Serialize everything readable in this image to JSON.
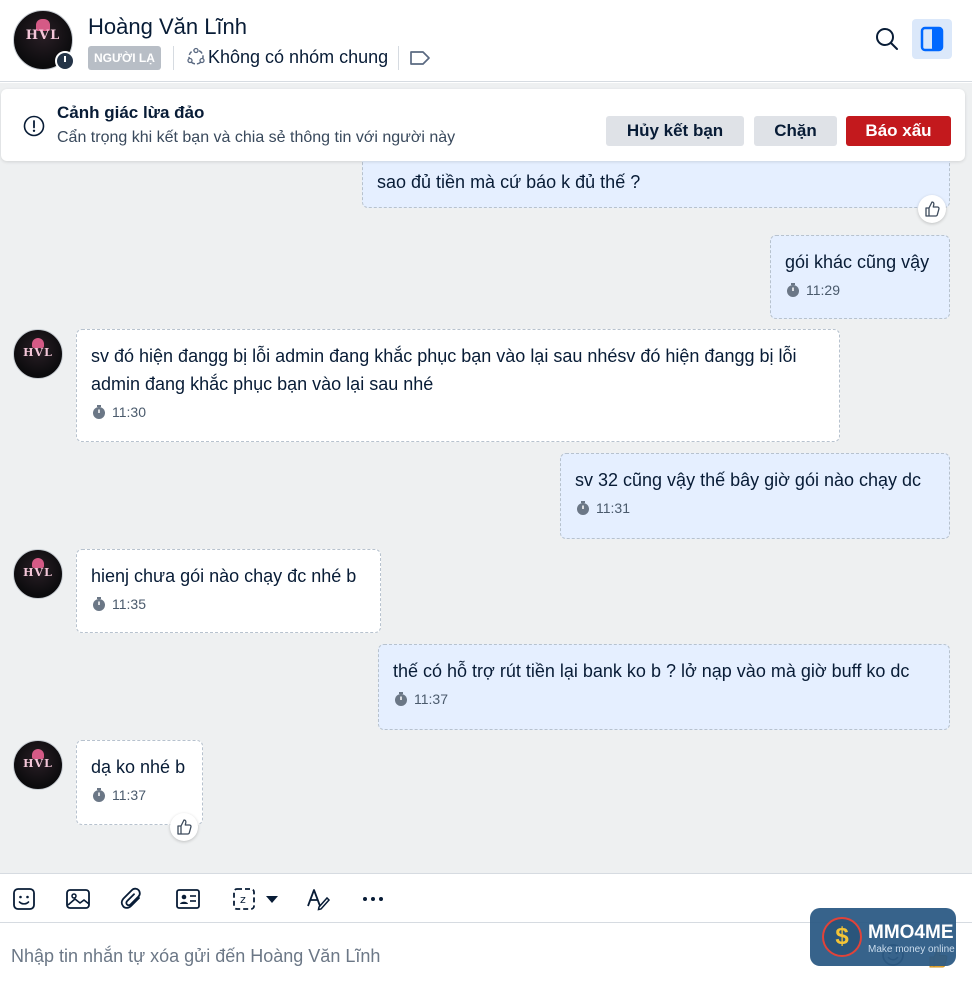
{
  "header": {
    "title": "Hoàng Văn Lĩnh",
    "stranger_badge": "NGƯỜI LẠ",
    "no_common_group": "Không có nhóm chung",
    "avatar_text": "HVL"
  },
  "warning": {
    "title": "Cảnh giác lừa đảo",
    "subtitle": "Cẩn trọng khi kết bạn và chia sẻ thông tin với người này",
    "unfriend_label": "Hủy kết bạn",
    "block_label": "Chặn",
    "report_label": "Báo xấu"
  },
  "messages": [
    {
      "from": "me",
      "text": "sao đủ tiền mà cứ báo k đủ thế  ?",
      "time": ""
    },
    {
      "from": "me",
      "text": "gói khác cũng vậy",
      "time": "11:29"
    },
    {
      "from": "them",
      "text": "sv đó hiện đangg bị lỗi admin đang khắc phục bạn vào lại sau nhésv đó hiện đangg bị lỗi admin đang khắc phục bạn vào lại sau nhé",
      "time": "11:30"
    },
    {
      "from": "me",
      "text": "sv 32 cũng vậy thế bây giờ gói nào chạy dc",
      "time": "11:31"
    },
    {
      "from": "them",
      "text": "hienj chưa gói nào chạy đc nhé b",
      "time": "11:35"
    },
    {
      "from": "me",
      "text": "thế có hỗ trợ rút tiền lại bank ko b ? lở nạp vào mà giờ buff ko dc",
      "time": "11:37"
    },
    {
      "from": "them",
      "text": "dạ ko nhé b",
      "time": "11:37"
    }
  ],
  "composer": {
    "placeholder": "Nhập tin nhắn tự xóa gửi đến Hoàng Văn Lĩnh"
  },
  "watermark": {
    "title": "MMO4ME",
    "subtitle": "Make money online",
    "symbol": "$"
  },
  "colors": {
    "accent": "#0068ff",
    "my_bubble": "#e5efff",
    "report": "#c3191d"
  }
}
